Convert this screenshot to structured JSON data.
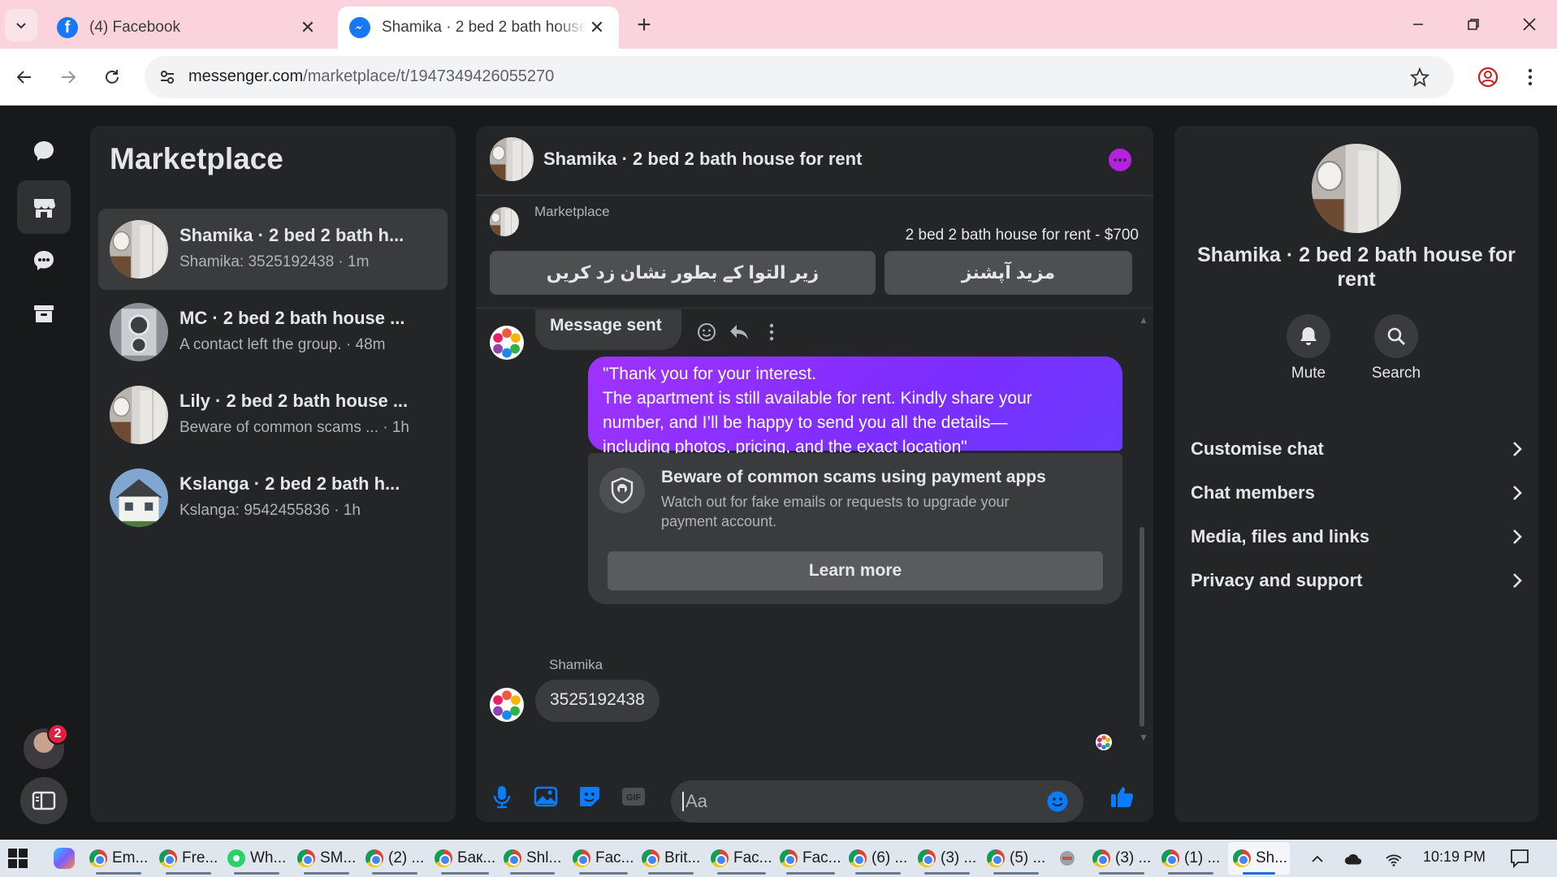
{
  "browser": {
    "tabs": [
      {
        "title": "(4) Facebook",
        "favicon": "facebook-icon",
        "active": false
      },
      {
        "title": "Shamika · 2 bed 2 bath house for rent",
        "favicon": "messenger-icon",
        "active": true
      }
    ],
    "url_host": "messenger.com",
    "url_path": "/marketplace/t/1947349426055270"
  },
  "sidebar_rail": {
    "badge_count": "2",
    "icons": [
      "chats-icon",
      "marketplace-icon",
      "requests-icon",
      "archive-icon"
    ]
  },
  "left_panel": {
    "title": "Marketplace",
    "conversations": [
      {
        "name": "Shamika · 2 bed 2 bath h...",
        "preview": "Shamika: 3525192438 · 1m"
      },
      {
        "name": "MC · 2 bed 2 bath house ...",
        "preview": "A contact left the group. · 48m"
      },
      {
        "name": "Lily · 2 bed 2 bath house ...",
        "preview": "Beware of common scams ... · 1h"
      },
      {
        "name": "Kslanga · 2 bed 2 bath h...",
        "preview": "Kslanga: 9542455836 · 1h"
      }
    ]
  },
  "chat": {
    "header_title": "Shamika · 2 bed 2 bath house for rent",
    "marketplace_label": "Marketplace",
    "listing": "2 bed 2 bath house for rent - $700",
    "mark_pending_button": "زیر التوا کے بطور نشان زد کریں",
    "more_options_button": "مزید آپشنز",
    "sent_status": "Message sent",
    "outgoing_message": [
      "\"Thank you for your interest.",
      "The apartment is still available for rent. Kindly share your",
      "number, and I’ll be happy to send you all the details—",
      "including photos, pricing, and the exact location\""
    ],
    "scam_warning": {
      "title": "Beware of common scams using payment apps",
      "body": "Watch out for fake emails or requests to upgrade your payment account.",
      "button": "Learn more"
    },
    "incoming_sender": "Shamika",
    "incoming_message": "3525192438",
    "composer_placeholder": "Aa",
    "accent_color": "#a033ff"
  },
  "right_panel": {
    "name": "Shamika · 2 bed 2 bath house for rent",
    "actions": [
      {
        "label": "Mute",
        "icon": "bell-icon"
      },
      {
        "label": "Search",
        "icon": "search-icon"
      }
    ],
    "rows": [
      "Customise chat",
      "Chat members",
      "Media, files and links",
      "Privacy and support"
    ]
  },
  "taskbar": {
    "items": [
      "Em...",
      "Fre...",
      "Wh...",
      "SM...",
      "(2) ...",
      "Бак...",
      "Shl...",
      "Fac...",
      "Brit...",
      "Fac...",
      "Fac...",
      "(6) ...",
      "(3) ...",
      "(5) ...",
      "(3) ...",
      "(1) ...",
      "Sh..."
    ],
    "clock": "10:19 PM"
  }
}
